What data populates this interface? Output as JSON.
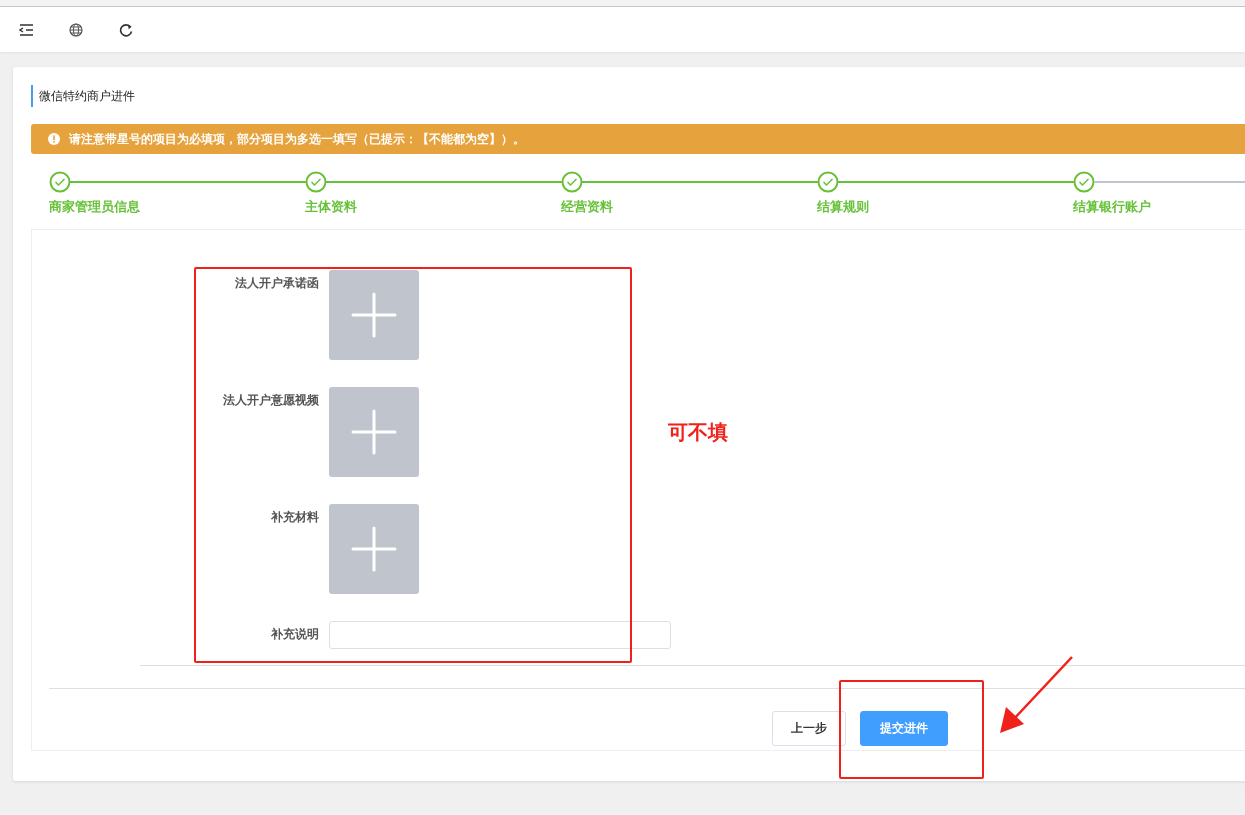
{
  "toolbar": {
    "buttons": [
      {
        "kind": "collapse"
      },
      {
        "kind": "globe"
      },
      {
        "kind": "refresh"
      }
    ]
  },
  "card": {
    "title": "微信特约商户进件",
    "alert": {
      "text": "请注意带星号的项目为必填项，部分项目为多选一填写（已提示：【不能都为空】）。"
    },
    "steps": [
      {
        "label": "商家管理员信息",
        "completed": true
      },
      {
        "label": "主体资料",
        "completed": true
      },
      {
        "label": "经营资料",
        "completed": true
      },
      {
        "label": "结算规则",
        "completed": true
      },
      {
        "label": "结算银行账户",
        "completed": true
      }
    ],
    "form": {
      "fields": [
        {
          "kind": "upload",
          "label": "法人开户承诺函"
        },
        {
          "kind": "upload",
          "label": "法人开户意愿视频"
        },
        {
          "kind": "upload",
          "label": "补充材料"
        },
        {
          "kind": "text",
          "label": "补充说明"
        }
      ]
    },
    "buttons": [
      {
        "label": "上一步",
        "kind": "default"
      },
      {
        "label": "提交进件",
        "kind": "primary"
      }
    ]
  },
  "annotations": [
    {
      "kind": "frame"
    },
    {
      "kind": "note",
      "text": "可不填"
    },
    {
      "kind": "frame"
    },
    {
      "kind": "arrow"
    }
  ]
}
